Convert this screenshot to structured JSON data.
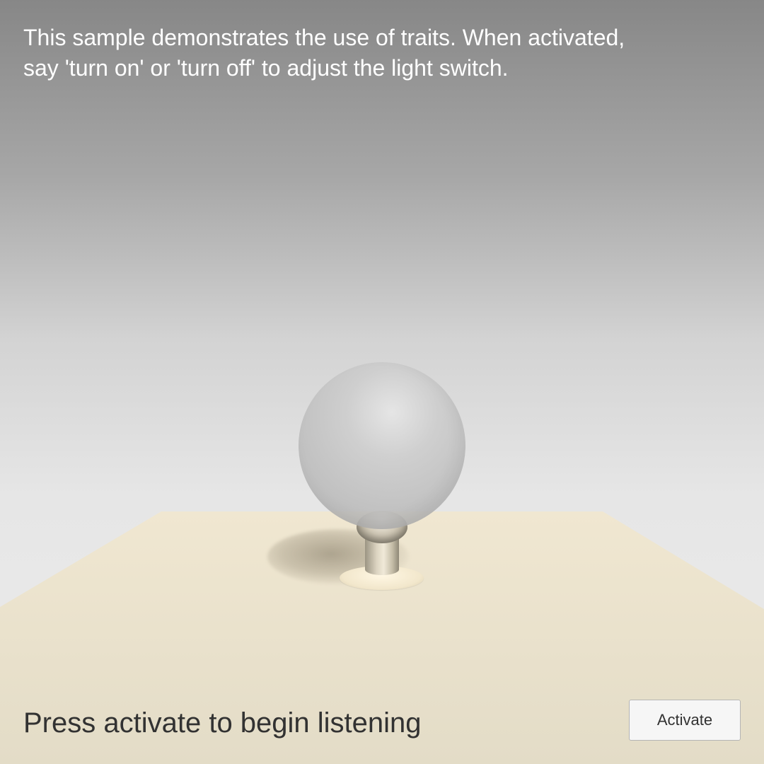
{
  "instructions": {
    "text": "This sample demonstrates the use of traits.  When activated,\nsay 'turn on' or 'turn off' to adjust the light switch."
  },
  "status": {
    "text": "Press activate to begin listening"
  },
  "activate_button": {
    "label": "Activate"
  },
  "scene": {
    "light_state": "off",
    "colors": {
      "sky_top": "#878787",
      "sky_bottom": "#ececec",
      "floor": "#e6dec8",
      "bulb": "#c3c3c3",
      "switch": "#e9e2cf",
      "text_light": "#ffffff",
      "text_dark": "#323232"
    }
  }
}
